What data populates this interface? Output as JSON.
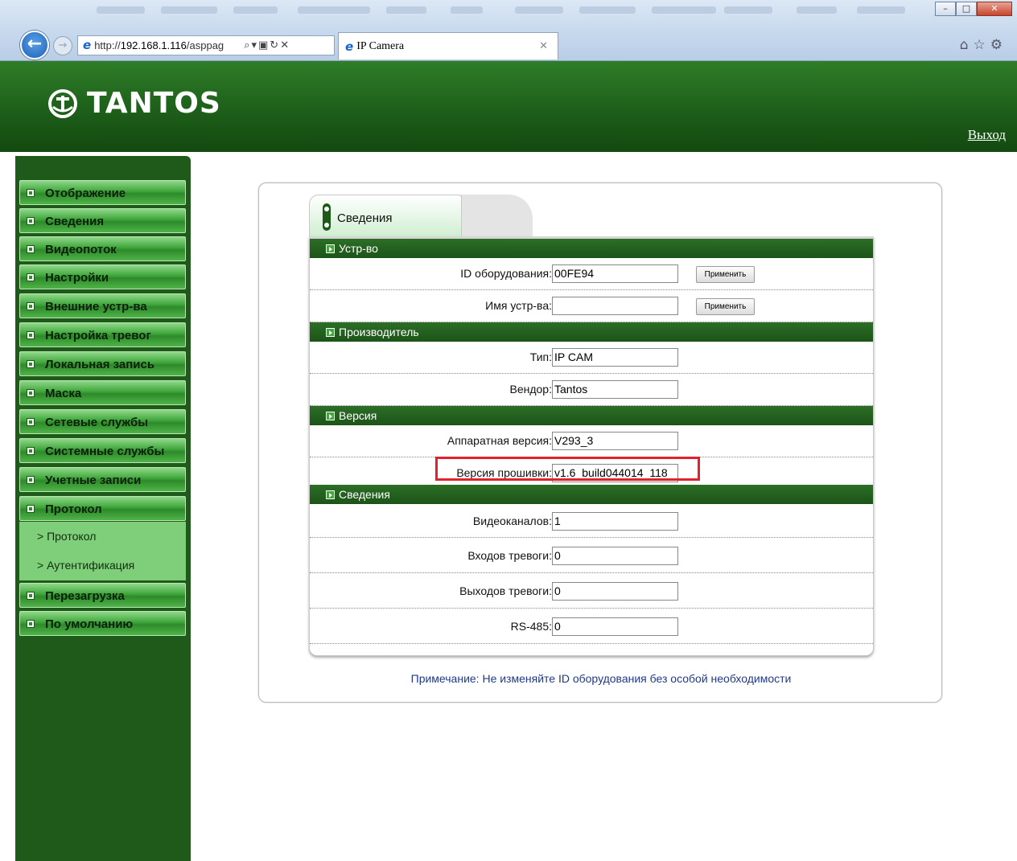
{
  "browser": {
    "url_prefix": "http://",
    "url_host": "192.168.1.116",
    "url_rest": "/asppag",
    "tab_title": "IP Camera",
    "window_controls": [
      "minimize",
      "maximize",
      "close"
    ]
  },
  "header": {
    "brand": "TANTOS",
    "logout": "Выход"
  },
  "sidebar": {
    "items": [
      {
        "label": "Отображение"
      },
      {
        "label": "Сведения"
      },
      {
        "label": "Видеопоток"
      },
      {
        "label": "Настройки"
      },
      {
        "label": "Внешние устр-ва"
      },
      {
        "label": "Настройка тревог"
      },
      {
        "label": "Локальная запись"
      },
      {
        "label": "Маска"
      },
      {
        "label": "Сетевые службы"
      },
      {
        "label": "Системные службы"
      },
      {
        "label": "Учетные записи"
      },
      {
        "label": "Протокол"
      },
      {
        "label": "Перезагрузка"
      },
      {
        "label": "По умолчанию"
      }
    ],
    "submenu": [
      {
        "label": "> Протокол"
      },
      {
        "label": "> Аутентификация"
      }
    ]
  },
  "panel": {
    "tab": "Сведения",
    "sections": {
      "device": {
        "title": "Устр-во",
        "rows": [
          {
            "label": "ID оборудования:",
            "value": "00FE94",
            "button": "Применить"
          },
          {
            "label": "Имя устр-ва:",
            "value": "",
            "button": "Применить"
          }
        ]
      },
      "maker": {
        "title": "Производитель",
        "rows": [
          {
            "label": "Тип:",
            "value": "IP CAM"
          },
          {
            "label": "Вендор:",
            "value": "Tantos"
          }
        ]
      },
      "version": {
        "title": "Версия",
        "rows": [
          {
            "label": "Аппаратная версия:",
            "value": "V293_3"
          },
          {
            "label": "Версия прошивки:",
            "value": "v1.6_build044014_118"
          }
        ]
      },
      "info": {
        "title": "Сведения",
        "rows": [
          {
            "label": "Видеоканалов:",
            "value": "1"
          },
          {
            "label": "Входов тревоги:",
            "value": "0"
          },
          {
            "label": "Выходов тревоги:",
            "value": "0"
          },
          {
            "label": "RS-485:",
            "value": "0"
          }
        ]
      }
    },
    "note": "Примечание: Не изменяйте ID оборудования без особой необходимости"
  },
  "colors": {
    "header_green": "#1d5f1a",
    "menu_green": "#3fa63a",
    "highlight": "#e0232a",
    "note_text": "#1f3a8a"
  }
}
